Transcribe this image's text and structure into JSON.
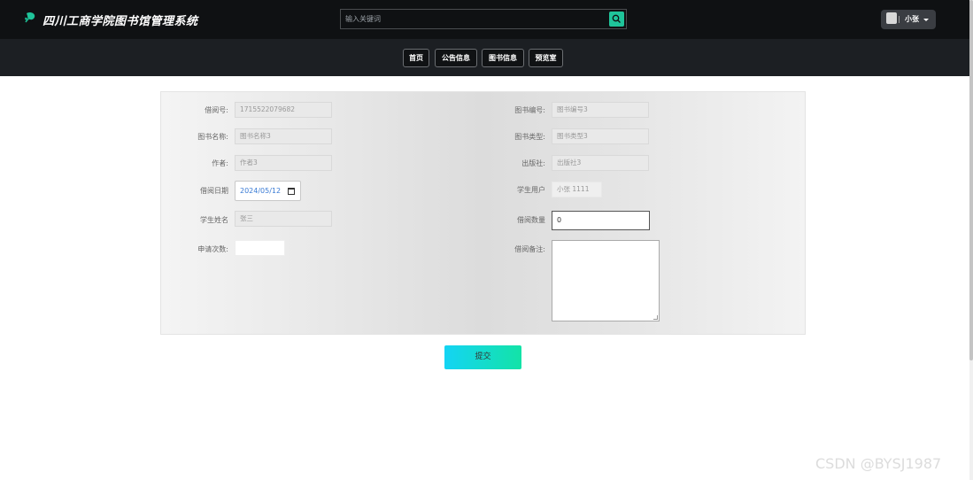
{
  "header": {
    "title": "四川工商学院图书馆管理系统",
    "search_placeholder": "输入关键词",
    "user_name": "小张",
    "logo_icon": "leaf-logo-icon",
    "search_icon": "search-icon"
  },
  "nav": {
    "items": [
      {
        "label": "首页"
      },
      {
        "label": "公告信息"
      },
      {
        "label": "图书信息"
      },
      {
        "label": "预览室"
      }
    ]
  },
  "form": {
    "borrow_no": {
      "label": "借阅号:",
      "value": "1715522079682"
    },
    "book_name": {
      "label": "图书名称:",
      "value": "图书名称3"
    },
    "author": {
      "label": "作者:",
      "value": "作者3"
    },
    "borrow_date": {
      "label": "借阅日期",
      "value": "2024/05/12"
    },
    "student_name": {
      "label": "学生姓名",
      "value": "张三"
    },
    "apply_count": {
      "label": "申请次数:",
      "value": ""
    },
    "book_no": {
      "label": "图书编号:",
      "value": "图书编号3"
    },
    "book_type": {
      "label": "图书类型:",
      "value": "图书类型3"
    },
    "publisher": {
      "label": "出版社:",
      "value": "出版社3"
    },
    "student_user": {
      "label": "学生用户",
      "value": "小张 1111"
    },
    "borrow_qty": {
      "label": "借阅数量",
      "value": "0"
    },
    "borrow_note": {
      "label": "借阅备注:",
      "value": ""
    }
  },
  "submit_label": "提交",
  "watermark": "CSDN @BYSJ1987",
  "colors": {
    "header_bg": "#0f1113",
    "nav_bg": "#1c1f23",
    "accent": "#1fc49a",
    "submit_gradient_start": "#14d4f4",
    "submit_gradient_end": "#13e3a7"
  }
}
